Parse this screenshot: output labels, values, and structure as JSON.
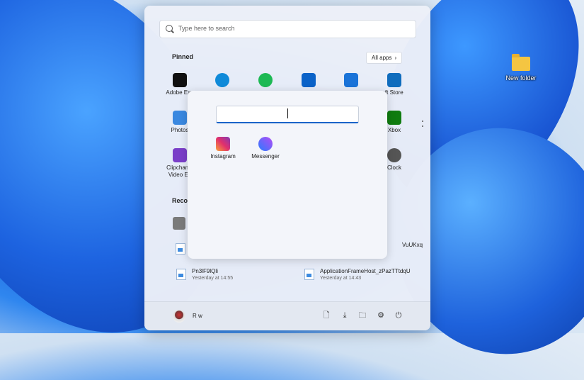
{
  "desktop": {
    "icon_label": "New folder"
  },
  "search": {
    "placeholder": "Type here to search"
  },
  "pinned": {
    "title": "Pinned",
    "all_apps": "All apps",
    "apps": [
      {
        "label": "Adobe Exp",
        "color": "#101010"
      },
      {
        "label": "",
        "color": "#0f8ad9"
      },
      {
        "label": "",
        "color": "#1db954"
      },
      {
        "label": "",
        "color": "#0a62c8"
      },
      {
        "label": "",
        "color": "#1a73d8"
      },
      {
        "label": "osoft Store",
        "color": "#0f6cbd"
      },
      {
        "label": "Photos",
        "color": "#3a88e0"
      },
      {
        "label": "Xbox",
        "color": "#107c10"
      },
      {
        "label": "Clipchamp\nVideo Ed",
        "color": "#7a3ec8"
      },
      {
        "label": "Clock",
        "color": "#555"
      }
    ]
  },
  "recommended": {
    "title": "Recom",
    "items": [
      {
        "name": "",
        "time": ""
      },
      {
        "name": "VuUKxq",
        "time": ""
      },
      {
        "name": "Pn3lF9lQli",
        "time": "Yesterday at 14:55"
      },
      {
        "name": "ApplicationFrameHost_zPazTTtdqU",
        "time": "Yesterday at 14:43"
      }
    ]
  },
  "footer": {
    "user": "R w"
  },
  "folder_popup": {
    "apps": [
      {
        "label": "Instagram"
      },
      {
        "label": "Messenger"
      }
    ]
  }
}
